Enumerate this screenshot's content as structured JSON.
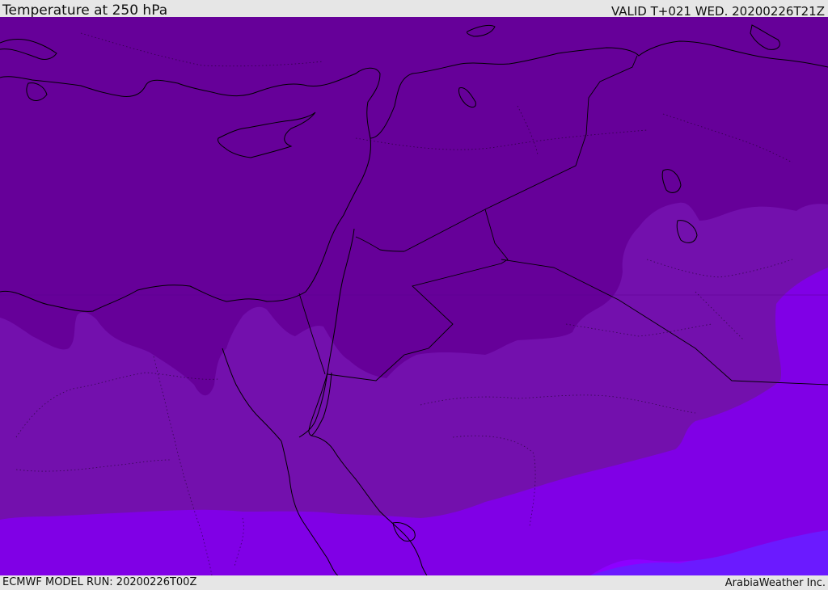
{
  "header": {
    "title": "Temperature at 250 hPa",
    "valid_time": "VALID T+021 WED. 20200226T21Z"
  },
  "footer": {
    "model_run": "ECMWF MODEL RUN: 20200226T00Z",
    "credit": "ArabiaWeather Inc."
  },
  "map": {
    "variable": "temperature",
    "level": "250 hPa",
    "palette": {
      "band_darkest": "#660099",
      "band_dark": "#7310ad",
      "band_mid": "#8000e6",
      "band_light": "#8d00ff",
      "band_blue": "#6b1aff",
      "coastline": "#000000"
    }
  }
}
